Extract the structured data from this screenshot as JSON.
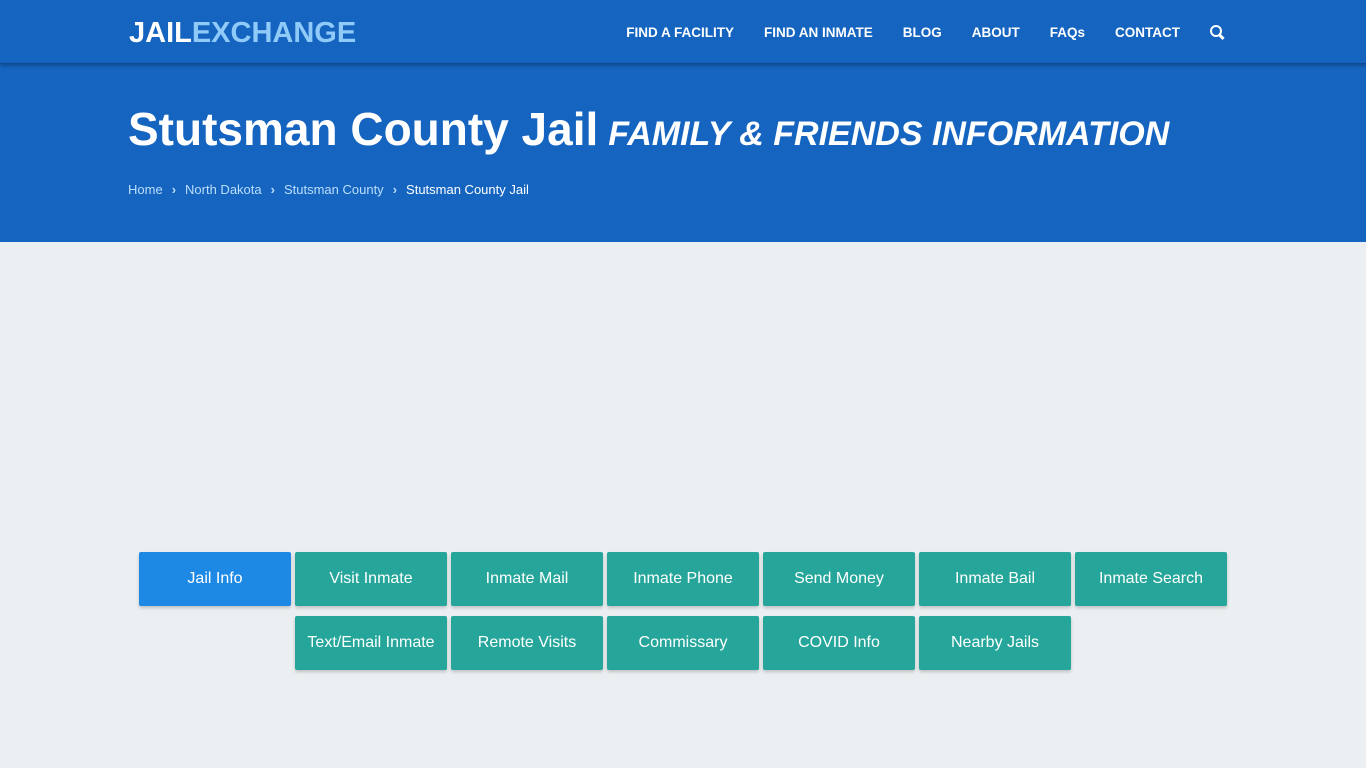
{
  "logo": {
    "part1": "JAIL",
    "part2": "EXCHANGE"
  },
  "nav": {
    "items": [
      "FIND A FACILITY",
      "FIND AN INMATE",
      "BLOG",
      "ABOUT",
      "FAQs",
      "CONTACT"
    ],
    "search_icon": "search-icon"
  },
  "hero": {
    "title": "Stutsman County Jail",
    "subtitle": "FAMILY & FRIENDS INFORMATION",
    "breadcrumb": [
      "Home",
      "North Dakota",
      "Stutsman County",
      "Stutsman County Jail"
    ]
  },
  "buttons": {
    "row1": [
      "Jail Info",
      "Visit Inmate",
      "Inmate Mail",
      "Inmate Phone",
      "Send Money",
      "Inmate Bail",
      "Inmate Search"
    ],
    "row2": [
      "Text/Email Inmate",
      "Remote Visits",
      "Commissary",
      "COVID Info",
      "Nearby Jails"
    ],
    "active": "Jail Info"
  },
  "colors": {
    "brand": "#1565c0",
    "accent": "#90caf9",
    "button": "#26a69a",
    "active_button": "#1e88e5"
  }
}
